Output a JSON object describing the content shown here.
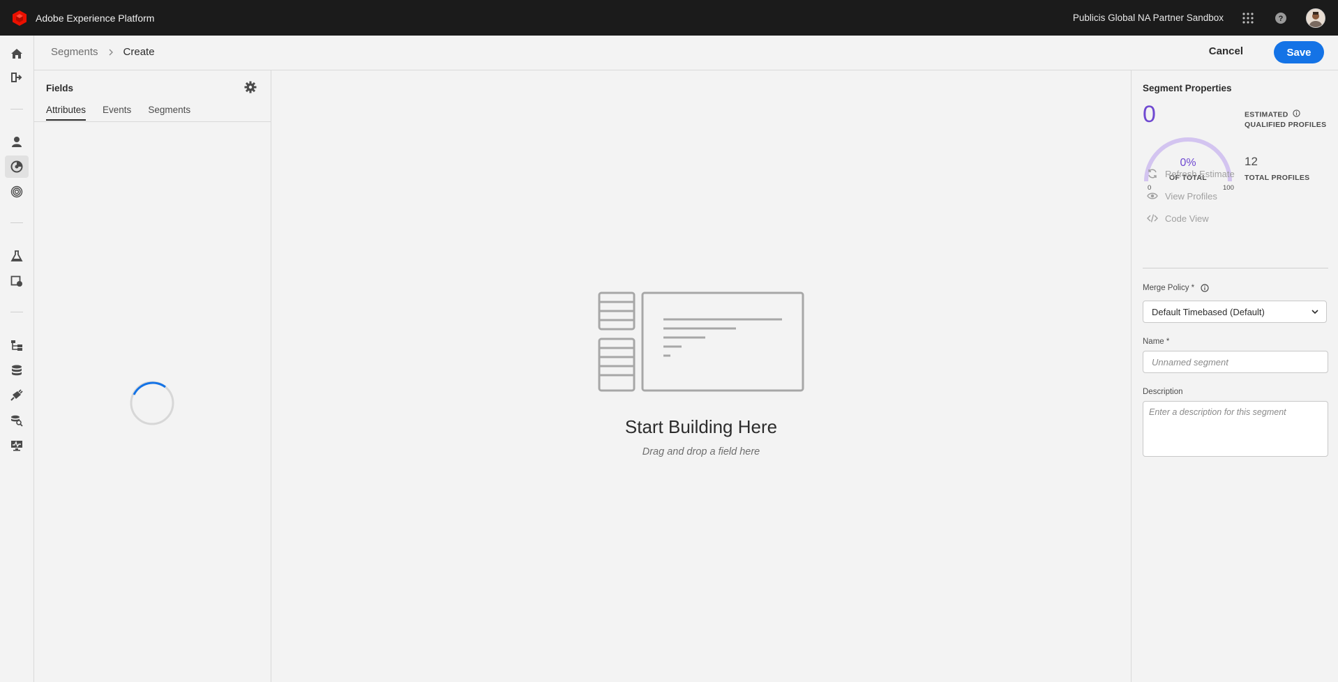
{
  "app": {
    "title": "Adobe Experience Platform",
    "sandbox": "Publicis Global NA Partner Sandbox",
    "brand_color": "#eb1000"
  },
  "topbar_icons": [
    "apps-grid-icon",
    "help-icon",
    "user-avatar"
  ],
  "rail": {
    "items": [
      {
        "name": "home-icon"
      },
      {
        "name": "workflows-icon"
      },
      {
        "name": "profiles-icon"
      },
      {
        "name": "segments-icon",
        "active": true
      },
      {
        "name": "identities-icon"
      },
      {
        "name": "data-science-icon"
      },
      {
        "name": "models-icon"
      },
      {
        "name": "schemas-icon"
      },
      {
        "name": "datasets-icon"
      },
      {
        "name": "sources-icon"
      },
      {
        "name": "queries-icon"
      },
      {
        "name": "monitoring-icon"
      }
    ]
  },
  "breadcrumb": {
    "parent": "Segments",
    "current": "Create"
  },
  "header": {
    "cancel_label": "Cancel",
    "save_label": "Save",
    "accent": "#1473e6"
  },
  "fields": {
    "title": "Fields",
    "tabs": [
      "Attributes",
      "Events",
      "Segments"
    ],
    "selected_tab": "Attributes"
  },
  "canvas": {
    "title": "Start Building Here",
    "subtitle": "Drag and drop a field here"
  },
  "properties": {
    "title": "Segment Properties",
    "qualified_count": "0",
    "estimated_label_1": "ESTIMATED",
    "estimated_label_2": "QUALIFIED PROFILES",
    "gauge_percent": "0%",
    "gauge_caption": "OF TOTAL",
    "gauge_min": "0",
    "gauge_max": "100",
    "total_count": "12",
    "total_label": "TOTAL PROFILES",
    "accent": "#6f49d1",
    "actions": [
      {
        "label": "Refresh Estimate",
        "icon": "refresh-icon"
      },
      {
        "label": "View Profiles",
        "icon": "eye-icon"
      },
      {
        "label": "Code View",
        "icon": "code-icon"
      }
    ],
    "merge_policy_label": "Merge Policy *",
    "merge_policy_value": "Default Timebased (Default)",
    "name_label": "Name *",
    "name_placeholder": "Unnamed segment",
    "description_label": "Description",
    "description_placeholder": "Enter a description for this segment"
  }
}
